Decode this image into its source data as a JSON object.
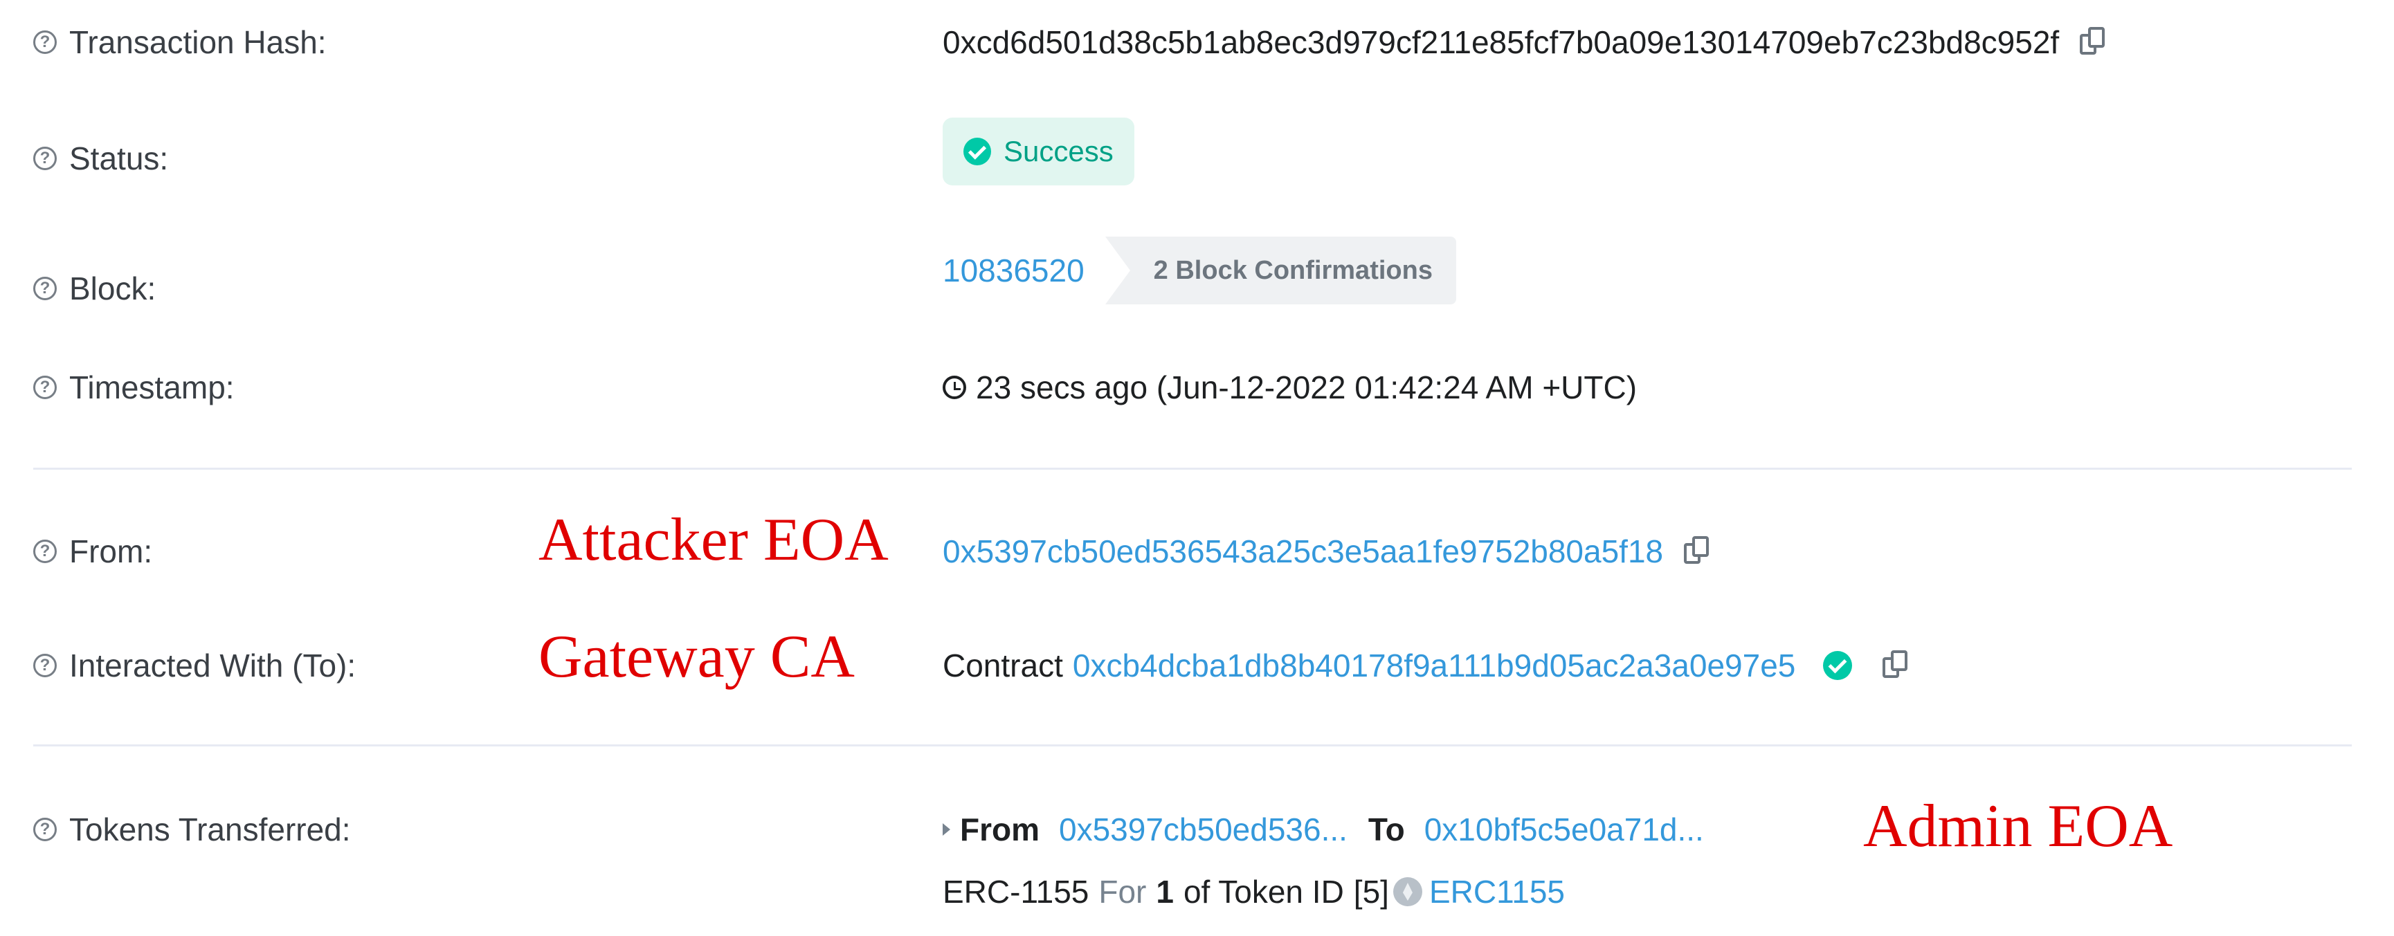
{
  "labels": {
    "tx_hash": "Transaction Hash:",
    "status": "Status:",
    "block": "Block:",
    "timestamp": "Timestamp:",
    "from": "From:",
    "interacted_with": "Interacted With (To):",
    "tokens_transferred": "Tokens Transferred:"
  },
  "help_glyph": "?",
  "tx_hash": "0xcd6d501d38c5b1ab8ec3d979cf211e85fcf7b0a09e13014709eb7c23bd8c952f",
  "status": {
    "label": "Success",
    "color": "#00a186",
    "background": "#e1f6f0"
  },
  "block": {
    "number": "10836520",
    "confirmations": "2 Block Confirmations"
  },
  "timestamp": "23 secs ago (Jun-12-2022 01:42:24 AM +UTC)",
  "from_address": "0x5397cb50ed536543a25c3e5aa1fe9752b80a5f18",
  "interacted_with": {
    "prefix": "Contract",
    "address": "0xcb4dcba1db8b40178f9a111b9d05ac2a3a0e97e5"
  },
  "tokens": {
    "from_label": "From",
    "from_address": "0x5397cb50ed536...",
    "to_label": "To",
    "to_address": "0x10bf5c5e0a71d...",
    "standard": "ERC-1155",
    "for_label": "For",
    "amount": "1",
    "of_token_id_label": "of Token ID",
    "token_id": "[5]",
    "token_name": "ERC1155"
  },
  "annotations": {
    "from": "Attacker EOA",
    "interacted_with": "Gateway CA",
    "tokens_to": "Admin EOA",
    "color": "#e00000"
  },
  "colors": {
    "link": "#3498db",
    "label": "#3a3f45",
    "divider": "#e7eaf3"
  }
}
